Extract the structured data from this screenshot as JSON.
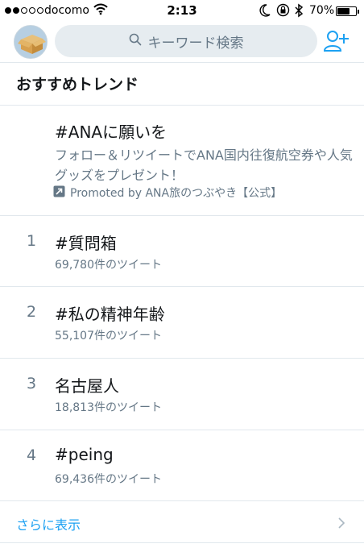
{
  "status_bar": {
    "carrier": "docomo",
    "time": "2:13",
    "battery_percent": "70%",
    "battery_level": 0.7,
    "signal_bars_filled": 2,
    "signal_bars_total": 5
  },
  "header": {
    "search_placeholder": "キーワード検索"
  },
  "section": {
    "title": "おすすめトレンド"
  },
  "promoted": {
    "name": "#ANAに願いを",
    "description": "フォロー＆リツイートでANA国内往復航空券や人気グッズをプレゼント！",
    "promoted_by": "Promoted by ANA旅のつぶやき【公式】"
  },
  "trends": [
    {
      "rank": "1",
      "name": "#質問箱",
      "count": "69,780件のツイート"
    },
    {
      "rank": "2",
      "name": "#私の精神年齢",
      "count": "55,107件のツイート"
    },
    {
      "rank": "3",
      "name": "名古屋人",
      "count": "18,813件のツイート"
    },
    {
      "rank": "4",
      "name": "#peing",
      "count": "69,436件のツイート"
    }
  ],
  "footer": {
    "show_more": "さらに表示"
  },
  "colors": {
    "accent": "#1da1f2",
    "secondary_text": "#657786",
    "primary_text": "#14171a",
    "divider": "#e1e8ed",
    "search_bg": "#e6ecf0"
  },
  "icons": {
    "search": "search-icon",
    "add_user": "add-user-icon",
    "promoted": "promoted-icon",
    "chevron": "chevron-right-icon",
    "wifi": "wifi-icon",
    "moon": "moon-icon",
    "rotation_lock": "rotation-lock-icon",
    "bluetooth": "bluetooth-icon",
    "avatar": "avatar"
  }
}
